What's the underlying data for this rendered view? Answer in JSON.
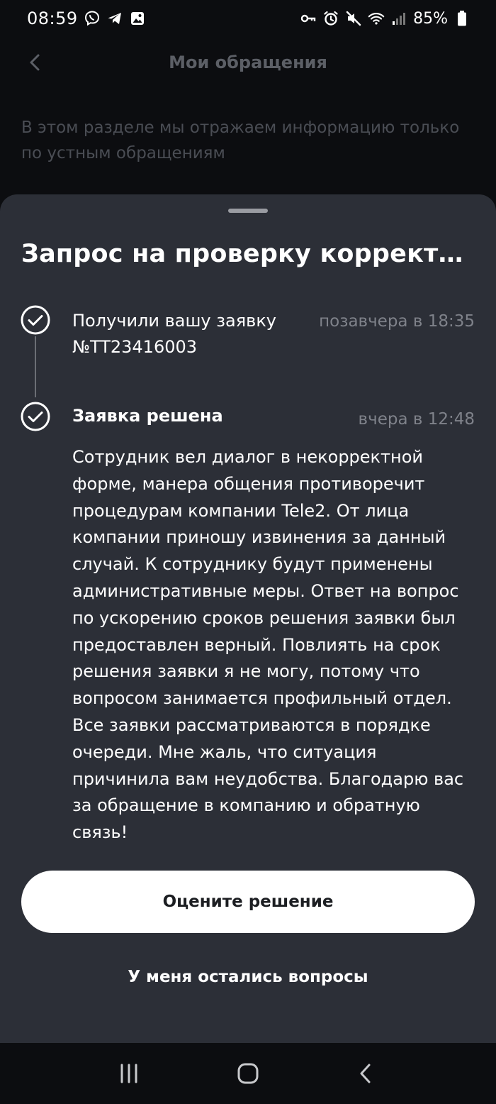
{
  "status_bar": {
    "time": "08:59",
    "battery": "85%",
    "left_icons": [
      "viber-icon",
      "telegram-icon",
      "gallery-icon"
    ],
    "right_icons": [
      "key-icon",
      "alarm-icon",
      "mute-icon",
      "wifi-icon",
      "signal-icon",
      "battery-icon"
    ]
  },
  "background_page": {
    "title": "Мои обращения",
    "info": "В этом разделе мы отражаем информацию только по устным обращениям"
  },
  "sheet": {
    "title": "Запрос на проверку корректност...",
    "steps": [
      {
        "title": "Получили вашу заявку №TT23416003",
        "time": "позавчера в 18:35"
      },
      {
        "title": "Заявка решена",
        "time": "вчера в 12:48",
        "body": "Сотрудник вел диалог в некорректной форме, манера общения противоречит процедурам компании Tele2. От лица компании приношу извинения за данный случай. К сотруднику будут применены административные меры. Ответ на вопрос по ускорению сроков решения заявки был предоставлен верный. Повлиять на срок решения заявки я не могу, потому что вопросом занимается профильный отдел. Все заявки рассматриваются в порядке очереди. Мне жаль, что ситуация причинила вам неудобства. Благодарю вас за обращение в компанию и обратную связь!"
      }
    ],
    "rate_button": "Оцените решение",
    "questions_link": "У меня остались вопросы"
  },
  "colors": {
    "sheet_background": "#2c2f37",
    "page_background": "#0c0d10",
    "muted_text": "#7f828a",
    "button_background": "#ffffff"
  }
}
